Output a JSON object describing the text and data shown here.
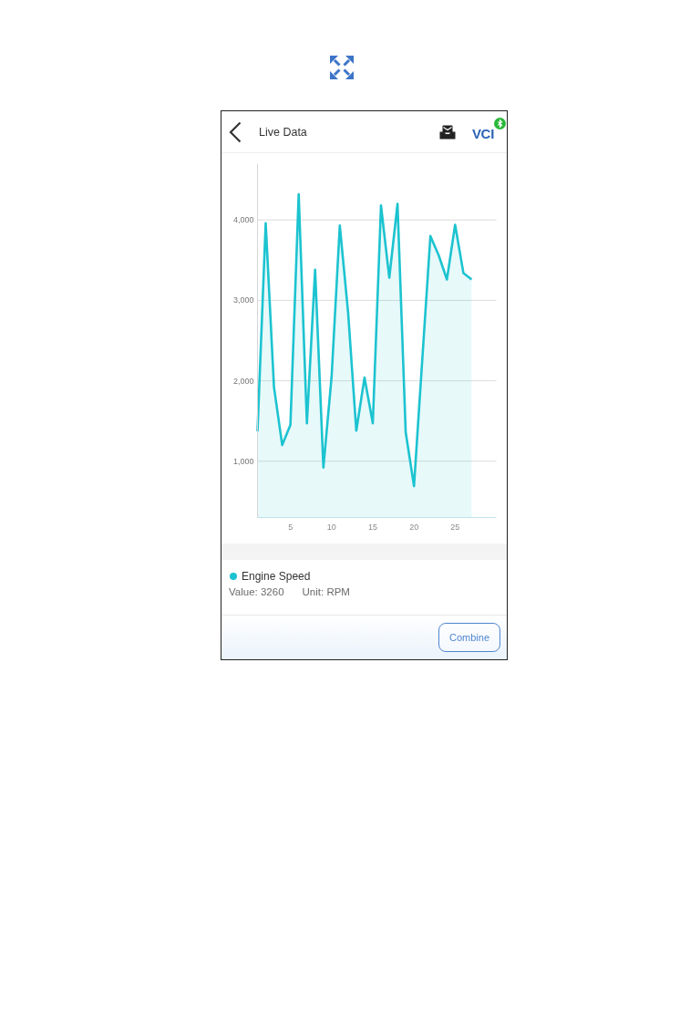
{
  "header": {
    "title": "Live Data",
    "vci": {
      "label": "VCI",
      "connected": true
    }
  },
  "chart": {
    "chart_data": {
      "type": "area",
      "grid": true,
      "x": [
        1,
        2,
        3,
        4,
        5,
        6,
        7,
        8,
        9,
        10,
        11,
        12,
        13,
        14,
        15,
        16,
        17,
        18,
        19,
        20,
        21,
        22,
        23,
        24,
        25,
        26,
        27
      ],
      "series": [
        {
          "color": "#1cc3d0",
          "values": [
            1370,
            3960,
            1920,
            1200,
            1450,
            4320,
            1470,
            3380,
            920,
            2050,
            3930,
            2850,
            1380,
            2040,
            1470,
            4180,
            3280,
            4200,
            1360,
            690,
            2250,
            3800,
            3560,
            3260,
            3940,
            3340,
            3260
          ]
        }
      ],
      "xlim": [
        1,
        30
      ],
      "ylim": [
        300,
        4700
      ],
      "xticks": [
        5,
        10,
        15,
        20,
        25
      ],
      "yticks": [
        {
          "value": 1000,
          "label": "1,000"
        },
        {
          "value": 2000,
          "label": "2,000"
        },
        {
          "value": 3000,
          "label": "3,000"
        },
        {
          "value": 4000,
          "label": "4,000"
        }
      ]
    }
  },
  "legend": {
    "name": "Engine Speed",
    "color": "#1cc3d0",
    "value": "Value: 3260",
    "unit": "Unit: RPM"
  },
  "footer": {
    "buttons": [
      {
        "label": "Combine"
      }
    ]
  }
}
